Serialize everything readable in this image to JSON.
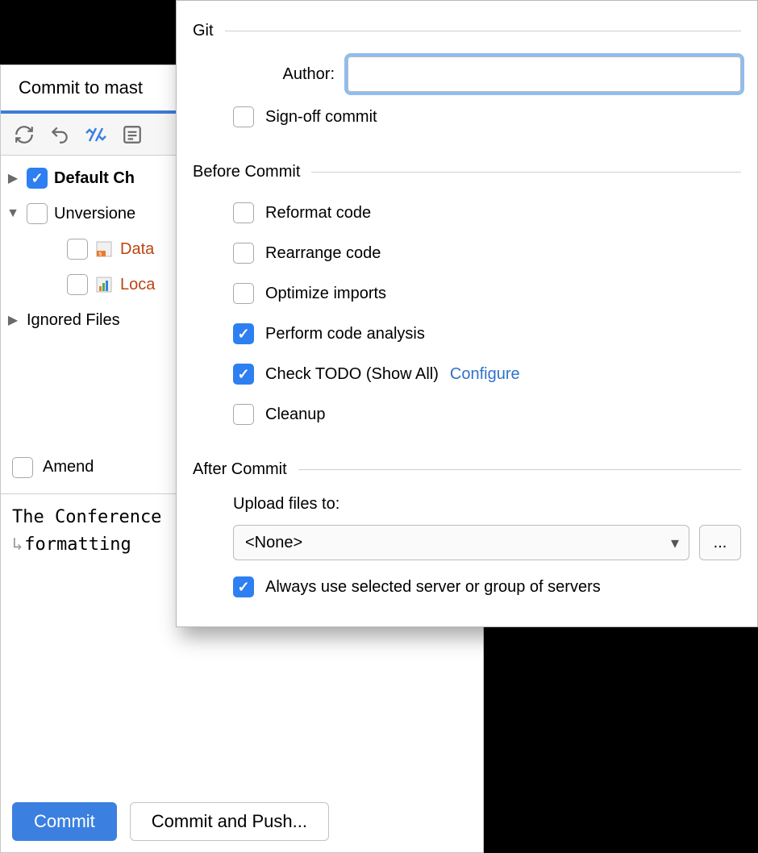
{
  "commit_panel": {
    "tab_title": "Commit to mast",
    "toolbar": {
      "refresh": "refresh",
      "undo": "undo",
      "diff": "diff",
      "changelists": "changelists"
    },
    "tree": {
      "default_changelist": {
        "label": "Default Ch",
        "checked": true,
        "expanded": false
      },
      "unversioned": {
        "label": "Unversione",
        "checked": false,
        "expanded": true,
        "files": [
          {
            "name": "Data",
            "icon": "datasource"
          },
          {
            "name": "Loca",
            "icon": "barchart"
          }
        ]
      },
      "ignored": {
        "label": "Ignored Files",
        "expanded": false
      }
    },
    "amend": {
      "label": "Amend",
      "checked": false
    },
    "message_line1": "The Conference",
    "message_line2": "formatting ",
    "commit_btn": "Commit",
    "commit_push_btn": "Commit and Push..."
  },
  "popover": {
    "sections": {
      "git": {
        "title": "Git",
        "author_label": "Author:",
        "author_value": "",
        "signoff": {
          "label": "Sign-off commit",
          "checked": false
        }
      },
      "before": {
        "title": "Before Commit",
        "options": [
          {
            "key": "reformat",
            "label": "Reformat code",
            "checked": false
          },
          {
            "key": "rearrange",
            "label": "Rearrange code",
            "checked": false
          },
          {
            "key": "optimize",
            "label": "Optimize imports",
            "checked": false
          },
          {
            "key": "analysis",
            "label": "Perform code analysis",
            "checked": true
          },
          {
            "key": "todo",
            "label": "Check TODO (Show All)",
            "checked": true,
            "link": "Configure"
          },
          {
            "key": "cleanup",
            "label": "Cleanup",
            "checked": false
          }
        ]
      },
      "after": {
        "title": "After Commit",
        "upload_label": "Upload files to:",
        "upload_value": "<None>",
        "always_use": {
          "label": "Always use selected server or group of servers",
          "checked": true
        }
      }
    }
  }
}
